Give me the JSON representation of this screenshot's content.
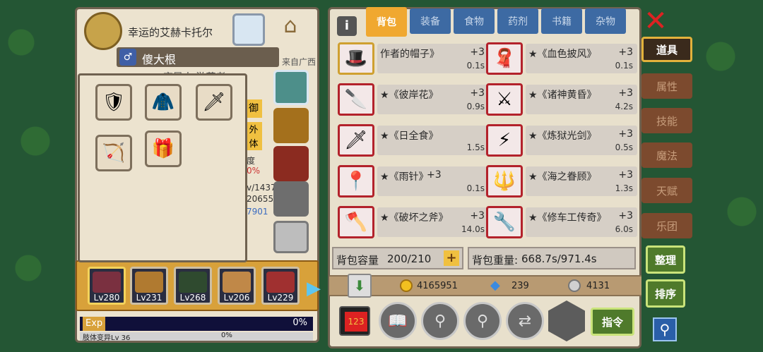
{
  "character": {
    "title": "幸运的艾赫卡托尔",
    "name": "傻大根",
    "origin": "来自广西",
    "subtitle": "变异人 游荡者",
    "partial_labels": [
      "御",
      "外",
      "体",
      "度"
    ],
    "partial_values": [
      "0%",
      "v/1437",
      "20655",
      "7901"
    ]
  },
  "equipment_popup": {
    "slots": [
      {
        "icon": "dark-armor-icon"
      },
      {
        "icon": "white-cloak-icon"
      },
      {
        "icon": "sword-icon"
      },
      {
        "icon": "crossbow-icon"
      },
      {
        "icon": "red-chest-armor-icon"
      }
    ]
  },
  "party": [
    {
      "level": "Lv280",
      "selected": true
    },
    {
      "level": "Lv231"
    },
    {
      "level": "Lv268"
    },
    {
      "level": "Lv206"
    },
    {
      "level": "Lv229"
    }
  ],
  "exp": {
    "label": "Exp",
    "percent": "0%",
    "skill": "肢体变异Lv 36",
    "skill_percent": "0%"
  },
  "tabs": [
    "背包",
    "装备",
    "食物",
    "药剂",
    "书籍",
    "杂物"
  ],
  "active_tab": "背包",
  "items": [
    {
      "name": "作者的帽子》",
      "level": "+3",
      "weight": "0.1s",
      "icon": "hat-icon"
    },
    {
      "name": "★《血色披风》",
      "level": "+3",
      "weight": "0.1s",
      "icon": "cape-icon"
    },
    {
      "name": "★《彼岸花》",
      "level": "+3",
      "weight": "0.9s",
      "icon": "blade-icon"
    },
    {
      "name": "★《诸神黄昏》",
      "level": "+3",
      "weight": "4.2s",
      "icon": "dark-sword-icon"
    },
    {
      "name": "★《日全食》",
      "level": "",
      "weight": "1.5s",
      "icon": "dagger-icon"
    },
    {
      "name": "★《炼狱光剑》",
      "level": "+3",
      "weight": "0.5s",
      "icon": "lightsaber-icon"
    },
    {
      "name": "★《雨针》",
      "level": "+3",
      "weight": "0.1s",
      "icon": "needle-icon"
    },
    {
      "name": "★《海之眷顾》",
      "level": "+3",
      "weight": "1.3s",
      "icon": "trident-icon"
    },
    {
      "name": "★《破坏之斧》",
      "level": "+3",
      "weight": "14.0s",
      "icon": "axe-icon"
    },
    {
      "name": "★《修车工传奇》",
      "level": "+3",
      "weight": "6.0s",
      "icon": "wrench-icon"
    }
  ],
  "capacity": {
    "label": "背包容量",
    "value": "200/210"
  },
  "weight": {
    "label": "背包重量:",
    "value": "668.7s/971.4s"
  },
  "currency": {
    "gold": "4165951",
    "diamond": "239",
    "silver": "4131"
  },
  "side_tabs": [
    "道具",
    "属性",
    "技能",
    "魔法",
    "天赋",
    "乐团"
  ],
  "active_side": "道具",
  "buttons": {
    "sort": "整理",
    "order": "排序",
    "command": "指令"
  },
  "colors": {
    "active_tab": "#f0a830",
    "tab": "#3d6aa3",
    "item_frame": "#b3222b",
    "panel": "#ece3cf"
  }
}
